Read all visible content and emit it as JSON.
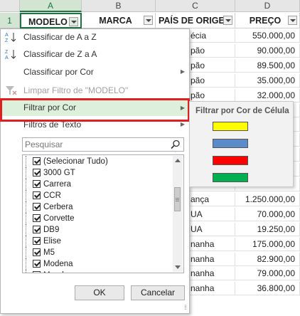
{
  "columns": [
    "A",
    "B",
    "C",
    "D"
  ],
  "row_numbers": [
    "1"
  ],
  "headers": [
    "MODELO",
    "MARCA",
    "PAÍS DE ORIGEM",
    "PREÇO"
  ],
  "visible_cells": [
    {
      "c": "écia",
      "d": "550.000,00"
    },
    {
      "c": "pão",
      "d": "90.000,00"
    },
    {
      "c": "pão",
      "d": "89.500,00"
    },
    {
      "c": "pão",
      "d": "35.000,00"
    },
    {
      "c": "pão",
      "d": "32.000,00"
    },
    {
      "c": "",
      "d": ""
    },
    {
      "c": "",
      "d": ""
    },
    {
      "c": "",
      "d": ""
    },
    {
      "c": "",
      "d": ""
    },
    {
      "c": "",
      "d": ""
    },
    {
      "c": "",
      "d": ""
    },
    {
      "c": "ança",
      "d": "1.250.000,00"
    },
    {
      "c": "UA",
      "d": "70.000,00"
    },
    {
      "c": "UA",
      "d": "19.250,00"
    },
    {
      "c": "nanha",
      "d": "175.000,00"
    },
    {
      "c": "nanha",
      "d": "82.900,00"
    },
    {
      "c": "nanha",
      "d": "79.000,00"
    },
    {
      "c": "nanha",
      "d": "36.800,00"
    }
  ],
  "menu": {
    "sort_az": "Classificar de A a Z",
    "sort_za": "Classificar de Z a A",
    "sort_by_color": "Classificar por Cor",
    "clear_filter": "Limpar Filtro de \"MODELO\"",
    "filter_by_color": "Filtrar por Cor",
    "text_filters": "Filtros de Texto",
    "search_placeholder": "Pesquisar",
    "items": [
      "(Selecionar Tudo)",
      "3000 GT",
      "Carrera",
      "CCR",
      "Cerbera",
      "Corvette",
      "DB9",
      "Elise",
      "M5",
      "Modena",
      "Mondeo"
    ],
    "ok": "OK",
    "cancel": "Cancelar"
  },
  "submenu": {
    "title": "Filtrar por Cor de Célula",
    "colors": [
      "#ffff00",
      "#5b8bc9",
      "#ff0000",
      "#00b050"
    ]
  }
}
